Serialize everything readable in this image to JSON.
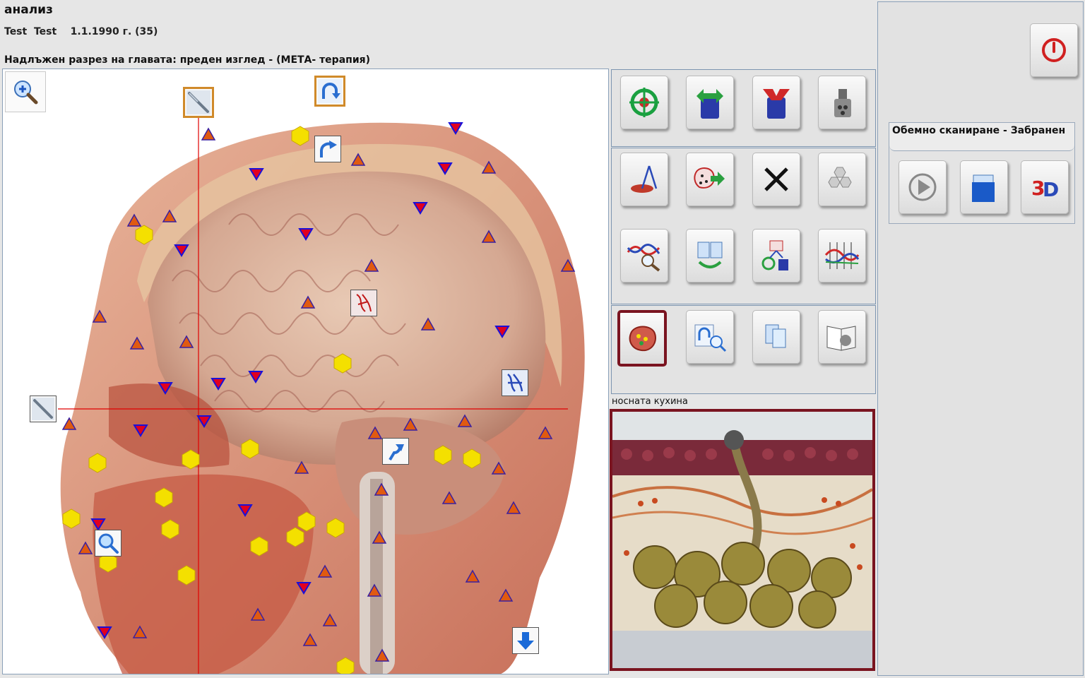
{
  "window": {
    "title": "анализ"
  },
  "patient": {
    "info": "Test  Test    1.1.1990 г. (35)"
  },
  "section": {
    "title": "Надлъжен разрез на главата: преден изглед - (МЕТА- терапия)"
  },
  "region": {
    "label": "носната кухина"
  },
  "scan": {
    "title": "Обемно сканиране - Забранен"
  },
  "icons": {
    "zoom": "zoom-in-icon",
    "scalpel": "scalpel-icon",
    "rotate": "rotate-icon",
    "magnifier": "magnifier-icon",
    "arrow_down": "arrow-down-icon",
    "power": "power-icon"
  },
  "colors": {
    "crosshair": "#e00000",
    "marker_hexagon": "#f4e000",
    "marker_triangle_up": "#e05a10",
    "marker_triangle_down": "#1a10d8",
    "selected_border": "#7a1420",
    "tool_border_orange": "#d08a2a"
  }
}
